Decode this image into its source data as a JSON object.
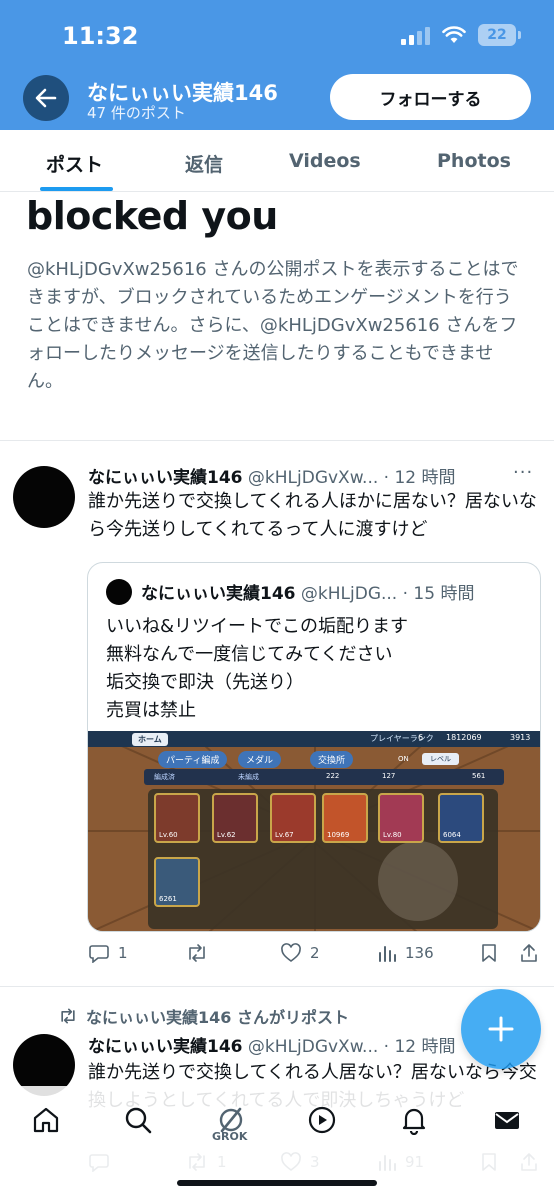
{
  "status_bar": {
    "time": "11:32",
    "battery": "22"
  },
  "header": {
    "name": "なにぃぃい実績146",
    "post_count": "47 件のポスト",
    "follow_label": "フォローする"
  },
  "tabs": [
    {
      "label": "ポスト"
    },
    {
      "label": "返信"
    },
    {
      "label": "Videos"
    },
    {
      "label": "Photos"
    }
  ],
  "blocked": {
    "title": "blocked you",
    "body": "@kHLjDGvXw25616 さんの公開ポストを表示することはできますが、ブロックされているためエンゲージメントを行うことはできません。さらに、@kHLjDGvXw25616 さんをフォローしたりメッセージを送信したりすることもできません。"
  },
  "posts": [
    {
      "name": "なにぃぃい実績146",
      "handle": "@kHLjDGvXw...",
      "time": "· 12 時間",
      "text": "誰か先送りで交換してくれる人ほかに居ない？居ないなら今先送りしてくれてるって人に渡すけど",
      "quote": {
        "name": "なにぃぃい実績146",
        "handle": "@kHLjDG...",
        "time": "· 15 時間",
        "lines": [
          "いいね&リツイートでこの垢配ります",
          "無料なんで一度信じてみてください",
          "垢交換で即決（先送り）",
          "売買は禁止"
        ],
        "media": {
          "player_rank_label": "プレイヤーランク",
          "player_rank": "6",
          "coins": "1812069",
          "gems": "3913",
          "home_label": "ホーム",
          "tabs": [
            "パーティ編成",
            "メダル",
            "交換所"
          ],
          "sort_labels": [
            "編成済",
            "未編成"
          ],
          "level_label": "レベル",
          "on_label": "ON",
          "stats": [
            "222",
            "127",
            "561"
          ],
          "cards": [
            {
              "lv": "Lv.60",
              "value": ""
            },
            {
              "lv": "Lv.62",
              "value": ""
            },
            {
              "lv": "Lv.67",
              "value": ""
            },
            {
              "lv": "",
              "value": "10969"
            },
            {
              "lv": "Lv.80",
              "value": ""
            },
            {
              "lv": "",
              "value": "6064"
            },
            {
              "lv": "",
              "value": "6261"
            }
          ]
        }
      },
      "actions": {
        "reply": "1",
        "repost": "",
        "like": "2",
        "views": "136"
      }
    },
    {
      "repost_label": "なにぃぃい実績146 さんがリポスト",
      "name": "なにぃぃい実績146",
      "handle": "@kHLjDGvXw...",
      "time": "· 12 時間",
      "text": "誰か先送りで交換してくれる人居ない？居ないなら今交換しようとしてくれてる人で即決しちゃうけど",
      "actions": {
        "reply": "",
        "repost": "1",
        "like": "3",
        "views": "91"
      }
    }
  ],
  "bottom_nav": {
    "grok_label": "GROK"
  },
  "colors": {
    "header_blue": "#4a97e6",
    "accent": "#1d9bf0",
    "text": "#0f1419",
    "muted": "#536471"
  }
}
